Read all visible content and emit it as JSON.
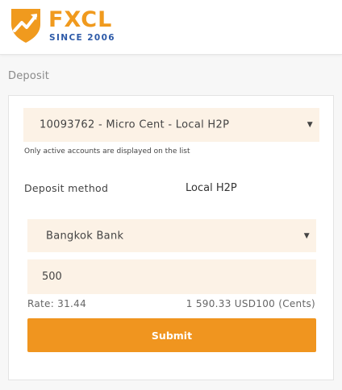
{
  "brand": {
    "name": "FXCL",
    "tagline": "SINCE 2006",
    "logo_icon": "shield-arrow-logo"
  },
  "page": {
    "title": "Deposit"
  },
  "deposit_form": {
    "account_select": {
      "value": "10093762 - Micro Cent - Local H2P",
      "caret": "▼"
    },
    "account_note": "Only active accounts are displayed on the list",
    "method_label": "Deposit method",
    "method_value": "Local H2P",
    "bank_select": {
      "value": "Bangkok Bank",
      "caret": "▼"
    },
    "amount": {
      "value": "500"
    },
    "rate_text": "Rate: 31.44",
    "converted_text": "1 590.33 USD100 (Cents)",
    "submit_label": "Submit"
  },
  "colors": {
    "accent": "#f0951f",
    "field_bg": "#fcf2e6",
    "brand_blue": "#2d5aa8"
  }
}
